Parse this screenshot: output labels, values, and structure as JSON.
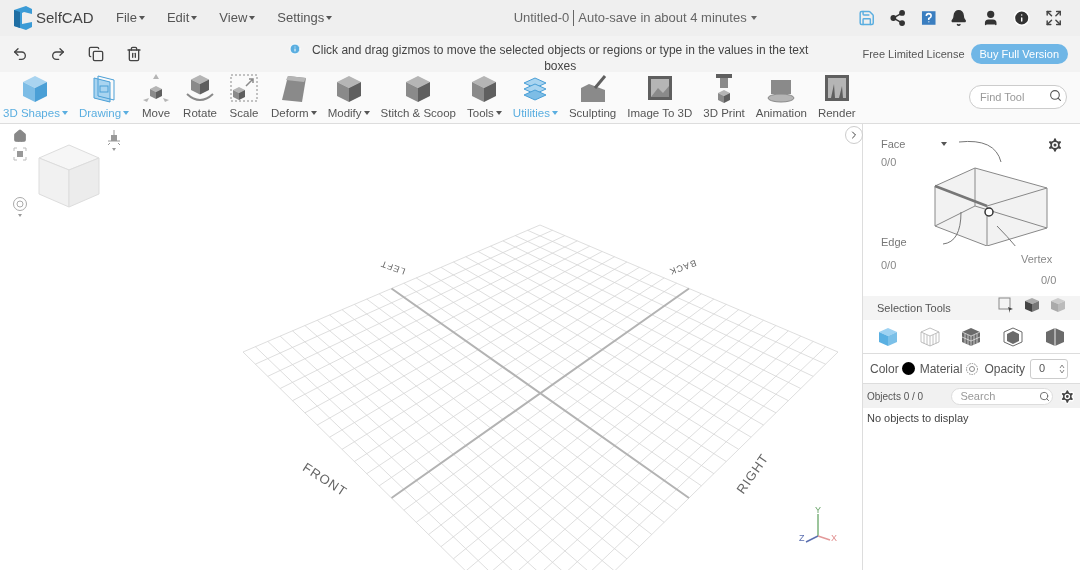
{
  "app": {
    "name": "SelfCAD"
  },
  "menu": [
    {
      "label": "File"
    },
    {
      "label": "Edit"
    },
    {
      "label": "View"
    },
    {
      "label": "Settings"
    }
  ],
  "document": {
    "title": "Untitled-0",
    "autosave": "Auto-save in about 4 minutes"
  },
  "hint": "Click and drag gizmos to move the selected objects or regions or type in the values in the text boxes",
  "license": "Free Limited License",
  "buy_button": "Buy Full Version",
  "tools": [
    {
      "label": "3D Shapes",
      "kind": "shapes",
      "highlighted": true,
      "dropdown": true
    },
    {
      "label": "Drawing",
      "kind": "drawing",
      "highlighted": true,
      "dropdown": true
    },
    {
      "label": "Move",
      "kind": "move",
      "highlighted": false,
      "dropdown": false
    },
    {
      "label": "Rotate",
      "kind": "rotate",
      "highlighted": false,
      "dropdown": false
    },
    {
      "label": "Scale",
      "kind": "scale",
      "highlighted": false,
      "dropdown": false
    },
    {
      "label": "Deform",
      "kind": "deform",
      "highlighted": false,
      "dropdown": true
    },
    {
      "label": "Modify",
      "kind": "modify",
      "highlighted": false,
      "dropdown": true
    },
    {
      "label": "Stitch & Scoop",
      "kind": "stitch",
      "highlighted": false,
      "dropdown": false
    },
    {
      "label": "Tools",
      "kind": "tools",
      "highlighted": false,
      "dropdown": true
    },
    {
      "label": "Utilities",
      "kind": "utilities",
      "highlighted": true,
      "dropdown": true
    },
    {
      "label": "Sculpting",
      "kind": "sculpt",
      "highlighted": false,
      "dropdown": false
    },
    {
      "label": "Image To 3D",
      "kind": "image",
      "highlighted": false,
      "dropdown": false
    },
    {
      "label": "3D Print",
      "kind": "print",
      "highlighted": false,
      "dropdown": false
    },
    {
      "label": "Animation",
      "kind": "animation",
      "highlighted": false,
      "dropdown": false
    },
    {
      "label": "Render",
      "kind": "render",
      "highlighted": false,
      "dropdown": false
    }
  ],
  "find_tool": {
    "placeholder": "Find Tool"
  },
  "viewport": {
    "left": "LEFT",
    "back": "BACK",
    "front": "FRONT",
    "right": "RIGHT",
    "axis_x": "X",
    "axis_y": "Y",
    "axis_z": "Z"
  },
  "panel": {
    "face": {
      "label": "Face",
      "count": "0/0"
    },
    "edge": {
      "label": "Edge",
      "count": "0/0"
    },
    "vertex": {
      "label": "Vertex",
      "count": "0/0"
    },
    "selection_tools": "Selection Tools",
    "modes": [
      {
        "kind": "solid",
        "selected": true
      },
      {
        "kind": "wire",
        "selected": false
      },
      {
        "kind": "grid",
        "selected": false
      },
      {
        "kind": "inner",
        "selected": false
      },
      {
        "kind": "half",
        "selected": false
      }
    ],
    "color_label": "Color",
    "color": "#000000",
    "material_label": "Material",
    "opacity_label": "Opacity",
    "opacity": "0",
    "objects": "Objects 0 / 0",
    "search_placeholder": "Search",
    "empty": "No objects to display"
  }
}
